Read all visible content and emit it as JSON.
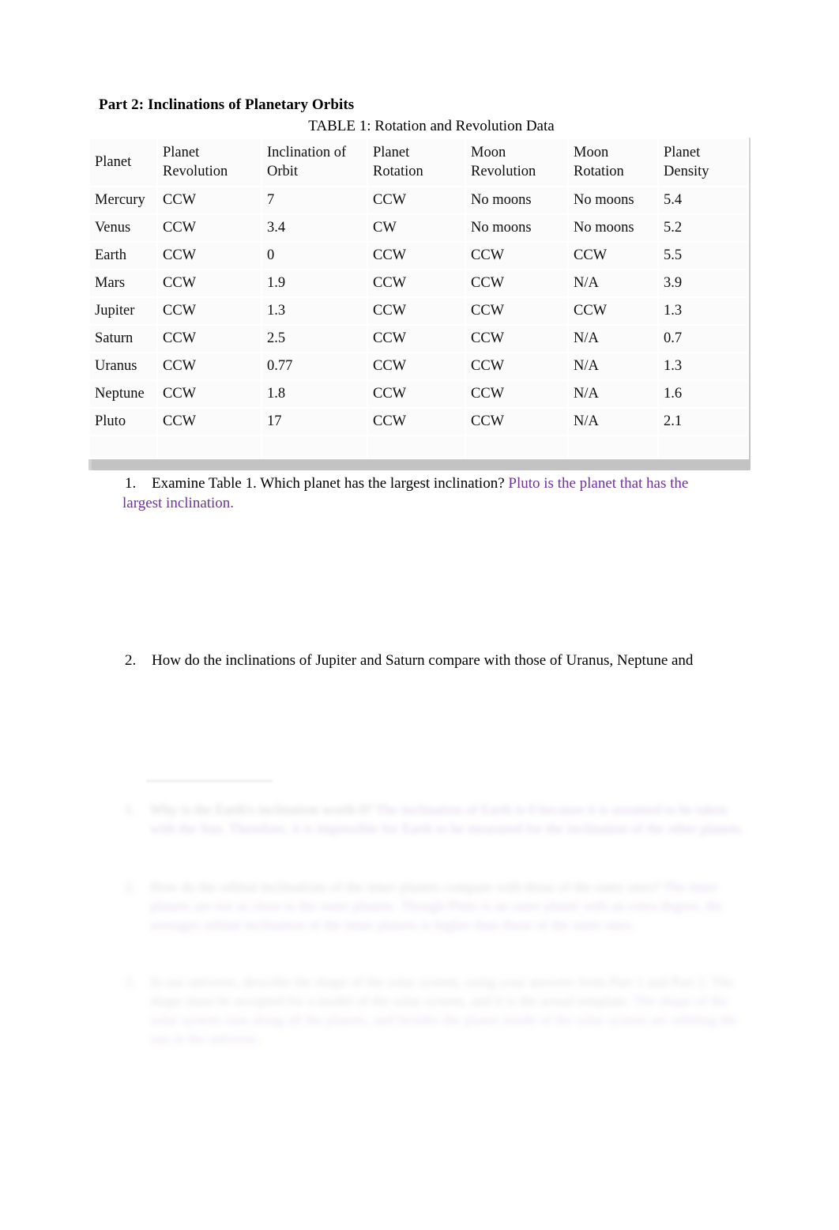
{
  "document": {
    "part_heading": "Part 2: Inclinations of Planetary Orbits",
    "table_caption": "TABLE 1: Rotation and Revolution Data"
  },
  "table": {
    "headers": [
      "Planet",
      "Planet Revolution",
      "Inclination of Orbit",
      "Planet Rotation",
      "Moon Revolution",
      "Moon Rotation",
      "Planet Density"
    ],
    "rows": [
      [
        "Mercury",
        "CCW",
        "7",
        "CCW",
        "No moons",
        "No moons",
        "5.4"
      ],
      [
        "Venus",
        "CCW",
        "3.4",
        "CW",
        "No moons",
        "No moons",
        "5.2"
      ],
      [
        "Earth",
        "CCW",
        "0",
        "CCW",
        "CCW",
        "CCW",
        "5.5"
      ],
      [
        "Mars",
        "CCW",
        "1.9",
        "CCW",
        "CCW",
        "N/A",
        "3.9"
      ],
      [
        "Jupiter",
        "CCW",
        "1.3",
        "CCW",
        "CCW",
        "CCW",
        "1.3"
      ],
      [
        "Saturn",
        "CCW",
        "2.5",
        "CCW",
        "CCW",
        "N/A",
        "0.7"
      ],
      [
        "Uranus",
        "CCW",
        "0.77",
        "CCW",
        "CCW",
        "N/A",
        "1.3"
      ],
      [
        "Neptune",
        "CCW",
        "1.8",
        "CCW",
        "CCW",
        "N/A",
        "1.6"
      ],
      [
        "Pluto",
        "CCW",
        "17",
        "CCW",
        "CCW",
        "N/A",
        "2.1"
      ]
    ]
  },
  "questions": [
    {
      "number": "1.",
      "prompt": "Examine Table 1. Which planet has the largest inclination? ",
      "answer": "Pluto is the planet that has the",
      "answer_continued": "largest inclination."
    },
    {
      "number": "2.",
      "prompt": "How do the inclinations of Jupiter and Saturn compare with those of Uranus, Neptune and",
      "answer": "",
      "answer_continued": ""
    }
  ],
  "faded_section": {
    "note": "illegible blurred text",
    "items": [
      {
        "number": "1.",
        "prompt_line1": "Why is the Earth's inclination worth 0?",
        "answer_line1": "The inclination of Earth is 0 because it is",
        "answer_line2": "assumed to be taken with the Sun. Therefore, it is impossible for Earth to be measured for the",
        "answer_line3": "inclination of the other planets."
      },
      {
        "number": "2.",
        "prompt_line1": "How do the orbital inclinations of the inner planets compare with those of the outer ones?",
        "answer_line1": "The inner planets are not as close to the outer planets. Though Pluto is an outer planet with an",
        "answer_line2": "extra degree, the averages orbital inclination of the inner planets is higher than those of the",
        "answer_line3": "outer ones."
      },
      {
        "number": "3.",
        "prompt_line1": "In our universe, describe the shape of the solar system, using your answers from Part 1",
        "prompt_line2": "and Part 2. The shape must be accepted for a model of the solar system, and it is the",
        "prompt_line3": "actual template.",
        "answer_line1": "The shape of the solar system runs along all the planets, and",
        "answer_line2": "besides the planet inside of the solar system are orbiting the sun in the universe."
      }
    ]
  },
  "colors": {
    "answer_purple": "#7030a0",
    "page_background": "#ffffff",
    "table_cell": "#fbfbfb",
    "table_shadow": "#d2d2d2"
  }
}
